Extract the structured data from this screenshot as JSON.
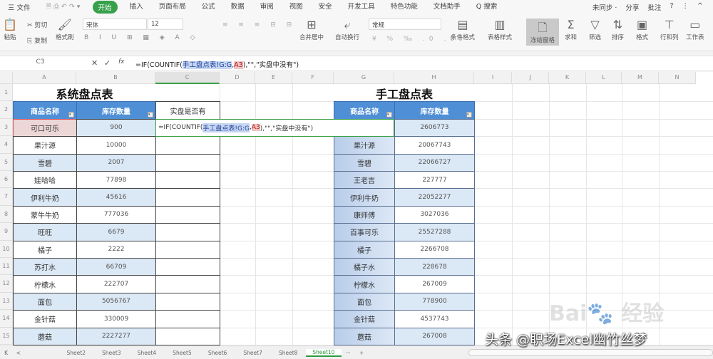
{
  "menu": {
    "app_menu": "三 文件",
    "items": [
      "开始",
      "插入",
      "页面布局",
      "公式",
      "数据",
      "审阅",
      "视图",
      "安全",
      "开发工具",
      "特色功能",
      "文档助手",
      "Q 搜索"
    ],
    "active": "开始",
    "right": [
      "未同步 ·",
      "分享",
      "批注",
      "?",
      "⋮",
      "^"
    ]
  },
  "ribbon": {
    "paste": "粘贴",
    "cut": "剪切",
    "copy": "复制",
    "format_painter": "格式刷",
    "font": "宋体",
    "size": "12",
    "number_format": "常规",
    "merge": "合并居中",
    "wrap": "自动换行",
    "cond_format": "条件格式",
    "table_style": "表格样式",
    "freeze": "冻结窗格",
    "sum": "求和",
    "filter": "筛选",
    "sort": "排序",
    "format": "格式",
    "rowcol": "行和列",
    "sheet": "工作表"
  },
  "formula_bar": {
    "name_box": "C3",
    "cancel": "✕",
    "confirm": "✓",
    "fx": "fx",
    "formula_pre": "=IF(COUNTIF(",
    "ref1": "手工盘点表!G:G",
    "sep": ",",
    "ref2": "A3",
    "formula_post": "),\"\",\"实盘中没有\")"
  },
  "columns": [
    "A",
    "B",
    "C",
    "D",
    "E",
    "F",
    "G",
    "H",
    "I",
    "J",
    "K",
    "L",
    "M",
    "N"
  ],
  "rows": [
    "1",
    "2",
    "3",
    "4",
    "5",
    "6",
    "7",
    "8",
    "9",
    "10",
    "11",
    "12",
    "13",
    "14",
    "15"
  ],
  "system_table": {
    "title": "系统盘点表",
    "headers": [
      "商品名称",
      "库存数量"
    ],
    "check_header": "实盘是否有",
    "items": [
      [
        "可口可乐",
        "900"
      ],
      [
        "果汁源",
        "10000"
      ],
      [
        "雪碧",
        "2007"
      ],
      [
        "娃哈哈",
        "77898"
      ],
      [
        "伊利牛奶",
        "45616"
      ],
      [
        "蒙牛牛奶",
        "777036"
      ],
      [
        "旺旺",
        "6679"
      ],
      [
        "橘子",
        "2222"
      ],
      [
        "苏打水",
        "66709"
      ],
      [
        "柠檬水",
        "222707"
      ],
      [
        "面包",
        "5056767"
      ],
      [
        "金针菇",
        "330009"
      ],
      [
        "蘑菇",
        "2227277"
      ]
    ]
  },
  "manual_table": {
    "title": "手工盘点表",
    "headers": [
      "商品名称",
      "库存数量"
    ],
    "items": [
      [
        "",
        "2606773"
      ],
      [
        "果汁源",
        "20067743"
      ],
      [
        "雪碧",
        "22066727"
      ],
      [
        "王老吉",
        "227777"
      ],
      [
        "伊利牛奶",
        "22052277"
      ],
      [
        "康师傅",
        "3027036"
      ],
      [
        "百事可乐",
        "25527288"
      ],
      [
        "橘子",
        "2266708"
      ],
      [
        "橘子水",
        "228678"
      ],
      [
        "柠檬水",
        "267009"
      ],
      [
        "面包",
        "778900"
      ],
      [
        "金针菇",
        "4537743"
      ],
      [
        "蘑菇",
        "267008"
      ]
    ]
  },
  "sheet_tabs": {
    "nav": [
      "K",
      "<"
    ],
    "tabs": [
      "Sheet2",
      "Sheet3",
      "Sheet4",
      "Sheet5",
      "Sheet6",
      "Sheet7",
      "Sheet8",
      "Sheet10"
    ],
    "active": "Sheet10",
    "more": "···",
    "add": "+"
  },
  "watermark": "头条 @职场Excel幽竹丝梦",
  "baidu_logo": "Bai du 经验"
}
